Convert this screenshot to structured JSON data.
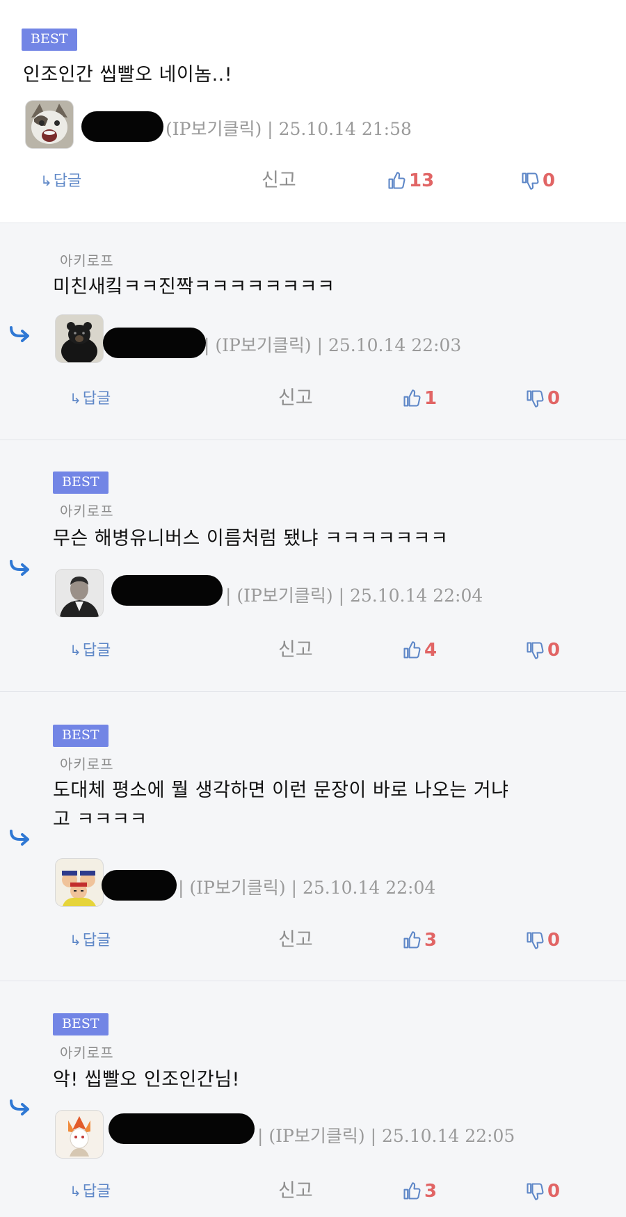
{
  "labels": {
    "best": "BEST",
    "reply": "답글",
    "report": "신고",
    "ip_toggle": "(IP보기클릭)",
    "separator": "|"
  },
  "colors": {
    "best_badge": "#7285e5",
    "like_count": "#e16565",
    "action_blue": "#5e87c7"
  },
  "comments": [
    {
      "best": true,
      "nickname_label": "",
      "text_lines": [
        "인조인간 씹빨오 네이놈..!"
      ],
      "avatar_icon": "cat-avatar-icon",
      "author": "",
      "date": "25.10.14 21:58",
      "likes": "13",
      "dislikes": "0"
    },
    {
      "best": false,
      "nickname_label": "아키로프",
      "text_lines": [
        "미친새킼ㅋㅋ진짝ㅋㅋㅋㅋㅋㅋㅋㅋ"
      ],
      "avatar_icon": "bear-avatar-icon",
      "author": "",
      "date": "25.10.14 22:03",
      "likes": "1",
      "dislikes": "0"
    },
    {
      "best": true,
      "nickname_label": "아키로프",
      "text_lines": [
        "무슨 해병유니버스 이름처럼 됐냐 ㅋㅋㅋㅋㅋㅋㅋ"
      ],
      "avatar_icon": "man-portrait-avatar-icon",
      "author": "",
      "date": "25.10.14 22:04",
      "likes": "4",
      "dislikes": "0"
    },
    {
      "best": true,
      "nickname_label": "아키로프",
      "text_lines": [
        "도대체 평소에 뭘 생각하면 이런 문장이 바로 나오는 거냐",
        "고 ㅋㅋㅋㅋ"
      ],
      "avatar_icon": "cartoon-group-avatar-icon",
      "author": "",
      "date": "25.10.14 22:04",
      "likes": "3",
      "dislikes": "0"
    },
    {
      "best": true,
      "nickname_label": "아키로프",
      "text_lines": [
        "악! 씹빨오 인조인간님!"
      ],
      "avatar_icon": "anime-character-avatar-icon",
      "author": "",
      "date": "25.10.14 22:05",
      "likes": "3",
      "dislikes": "0"
    }
  ]
}
